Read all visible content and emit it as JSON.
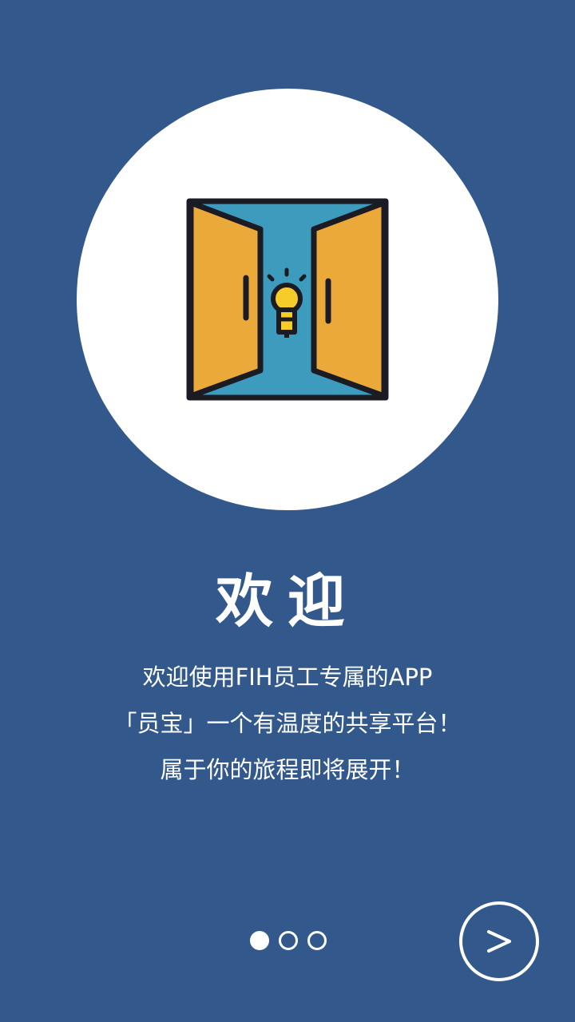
{
  "welcome": {
    "title": "欢迎",
    "lines": [
      "欢迎使用FIH员工专属的APP",
      "「员宝」一个有温度的共享平台！",
      "属于你的旅程即将展开！"
    ]
  },
  "pagination": {
    "current_page": 1,
    "total_pages": 3
  },
  "icons": {
    "hero": "open-door-lightbulb-icon",
    "next": "chevron-right-icon"
  },
  "colors": {
    "background": "#33598C",
    "circle": "#FFFFFF",
    "door_panel": "#EBA93A",
    "door_interior": "#3D9BBE",
    "bulb": "#F6CC2A",
    "outline": "#1B1B24"
  }
}
